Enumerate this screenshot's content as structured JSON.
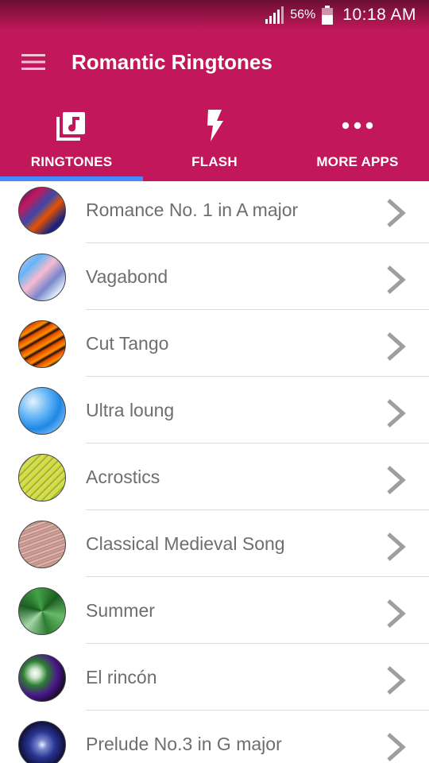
{
  "status_bar": {
    "battery_percent": "56%",
    "time": "10:18 AM"
  },
  "toolbar": {
    "title": "Romantic Ringtones"
  },
  "tabs": [
    {
      "label": "RINGTONES",
      "icon": "music-library-icon",
      "selected": true
    },
    {
      "label": "FLASH",
      "icon": "flash-icon",
      "selected": false
    },
    {
      "label": "MORE APPS",
      "icon": "more-dots-icon",
      "selected": false
    }
  ],
  "ringtones": [
    {
      "title": "Romance No. 1 in A major",
      "thumb": "abstract-paint"
    },
    {
      "title": "Vagabond",
      "thumb": "pastel-streaks"
    },
    {
      "title": "Cut Tango",
      "thumb": "tiger-stripes"
    },
    {
      "title": "Ultra loung",
      "thumb": "blue-marble"
    },
    {
      "title": "Acrostics",
      "thumb": "lime-lines"
    },
    {
      "title": "Classical Medieval Song",
      "thumb": "rose-weave"
    },
    {
      "title": "Summer",
      "thumb": "green-cubes"
    },
    {
      "title": "El rincón",
      "thumb": "hexagon-gems"
    },
    {
      "title": "Prelude No.3 in G major",
      "thumb": "galaxy-swirl"
    }
  ],
  "colors": {
    "primary": "#c2185b",
    "tab_indicator": "#448aff",
    "list_text": "#6e6e6e",
    "chevron": "#9e9e9e"
  }
}
